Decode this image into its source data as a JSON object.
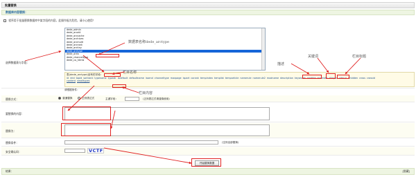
{
  "header": {
    "title": "批量替换"
  },
  "section": {
    "title": "数据库内容替换："
  },
  "note": {
    "text": "程序用于批量替换数据库中某字段的内容，此操作极为危险，请小心使用！"
  },
  "table_row": {
    "label": "选择数据表与字段：",
    "tables": [
      "dede_admin",
      "dede_arcatt",
      "dede_arccache",
      "dede_archives",
      "dede_arcmulti",
      "dede_arcrank",
      "dede_arctiny",
      "dede_arctype",
      "dede_area",
      "dede_channeltype",
      "dede_co_htmls"
    ],
    "selected_index": 7,
    "fields_title": "表(dede_arctype)含有的字段：",
    "fields_lines": [
      [
        "id",
        "reid",
        "topid",
        "sortrank",
        "typename",
        "typedir",
        "isdefault",
        "defaultname",
        "issend",
        "channeltype",
        "maxpage",
        "ispart",
        "corank",
        "tempindex",
        "templist",
        "temparticle",
        "namerule",
        "namerule2",
        "modname",
        "description",
        "keywords",
        "seotitle",
        "moresite",
        "sitepurl",
        "siteurl",
        "ishidden",
        "cross",
        "crossid"
      ],
      [
        "content",
        "smalltypes"
      ]
    ]
  },
  "condition_label": "请根据条件：",
  "replace_mode": {
    "label": "替换方式：",
    "options": [
      "普通替换",
      "正则表达式"
    ],
    "key_label": "主键字段：",
    "hint": "(正则表达式请谨慎使用)"
  },
  "find_row": {
    "label": "要替换的内容："
  },
  "replace_row": {
    "label": "替换为："
  },
  "where_row": {
    "label": "替换条件：",
    "hint": "(空则全部替换)"
  },
  "captcha_row": {
    "label": "安全确认码：",
    "code": "VCTF"
  },
  "submit": {
    "label": "开始替换数据"
  },
  "footer": {
    "left": "结果：",
    "right": "[隐藏]"
  },
  "annotations": {
    "table_name": "数据表名称dede_arctype",
    "field_name": "栏目名称",
    "desc": "描述",
    "keyword": "关键词",
    "seo": "栏目标题",
    "content": "栏目内容"
  }
}
